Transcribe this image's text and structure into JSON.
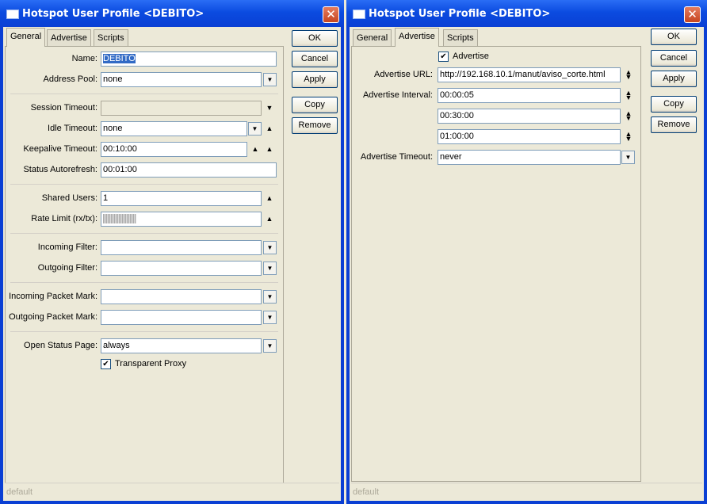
{
  "left_window": {
    "title": "Hotspot User Profile <DEBITO>",
    "tabs": [
      "General",
      "Advertise",
      "Scripts"
    ],
    "fields": {
      "name": {
        "label": "Name:",
        "value": "DEBITO"
      },
      "address_pool": {
        "label": "Address Pool:",
        "value": "none"
      },
      "session_timeout": {
        "label": "Session Timeout:",
        "value": ""
      },
      "idle_timeout": {
        "label": "Idle Timeout:",
        "value": "none"
      },
      "keepalive_timeout": {
        "label": "Keepalive Timeout:",
        "value": "00:10:00"
      },
      "status_autorefresh": {
        "label": "Status Autorefresh:",
        "value": "00:01:00"
      },
      "shared_users": {
        "label": "Shared Users:",
        "value": "1"
      },
      "rate_limit": {
        "label": "Rate Limit (rx/tx):",
        "value": ""
      },
      "incoming_filter": {
        "label": "Incoming Filter:",
        "value": ""
      },
      "outgoing_filter": {
        "label": "Outgoing Filter:",
        "value": ""
      },
      "incoming_packet_mark": {
        "label": "Incoming Packet Mark:",
        "value": ""
      },
      "outgoing_packet_mark": {
        "label": "Outgoing Packet Mark:",
        "value": ""
      },
      "open_status_page": {
        "label": "Open Status Page:",
        "value": "always"
      }
    },
    "transparent_proxy": {
      "label": "Transparent Proxy",
      "checked": true
    },
    "buttons": {
      "ok": "OK",
      "cancel": "Cancel",
      "apply": "Apply",
      "copy": "Copy",
      "remove": "Remove"
    },
    "status": "default"
  },
  "right_window": {
    "title": "Hotspot User Profile <DEBITO>",
    "tabs": [
      "General",
      "Advertise",
      "Scripts"
    ],
    "advertise": {
      "label": "Advertise",
      "checked": true
    },
    "advertise_url": {
      "label": "Advertise URL:",
      "value": "http://192.168.10.1/manut/aviso_corte.html"
    },
    "advertise_interval": {
      "label": "Advertise Interval:",
      "values": [
        "00:00:05",
        "00:30:00",
        "01:00:00"
      ]
    },
    "advertise_timeout": {
      "label": "Advertise Timeout:",
      "value": "never"
    },
    "buttons": {
      "ok": "OK",
      "cancel": "Cancel",
      "apply": "Apply",
      "copy": "Copy",
      "remove": "Remove"
    },
    "status": "default"
  },
  "icons": {
    "close": "close-icon",
    "dropdown": "dropdown-arrow-icon",
    "up": "up-arrow-icon",
    "updown": "up-down-arrow-icon",
    "check": "check-icon"
  },
  "colors": {
    "title_bar": "#0a3fd4",
    "window_bg": "#ece9d8",
    "selection": "#316ac5",
    "close_button": "#c6451f"
  }
}
